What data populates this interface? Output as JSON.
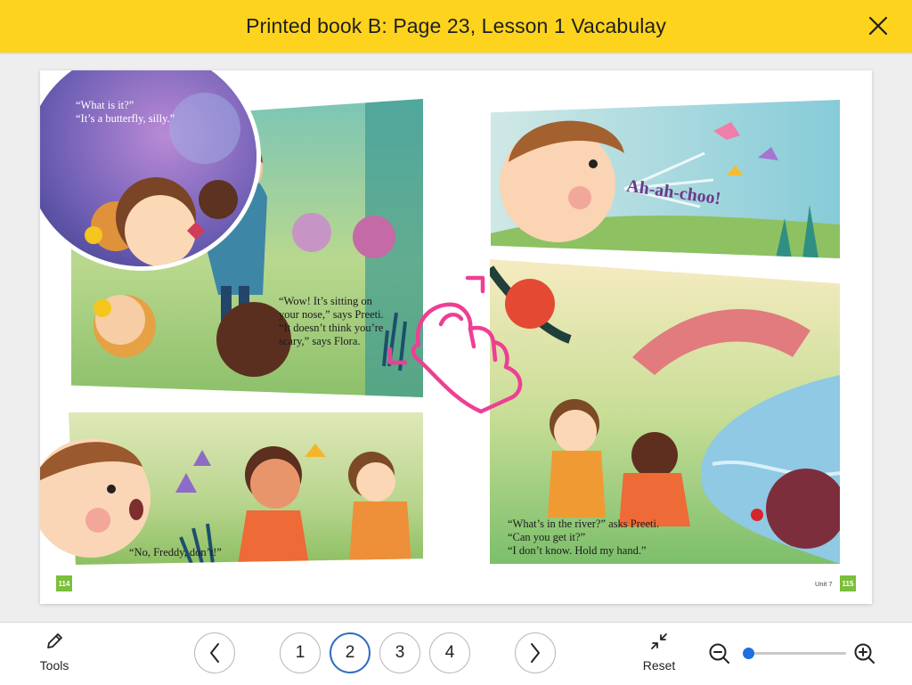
{
  "header": {
    "title": "Printed book B: Page 23, Lesson 1 Vacabulay",
    "close_icon": "close-icon"
  },
  "book": {
    "captions": {
      "butterfly": "“What is it?”\n“It’s a butterfly, silly.”",
      "nose": "“Wow! It’s sitting on\nyour nose,” says Preeti.\n“It doesn’t think you’re\nscary,” says Flora.",
      "freddy": "“No, Freddy, don’t!”",
      "sneeze": "Ah-ah-choo!",
      "river": "“What’s in the river?” asks Preeti.\n“Can you get it?”\n“I don’t know. Hold my hand.”"
    },
    "left_page_number": "114",
    "right_page_number": "115",
    "unit_label": "Unit 7",
    "gesture_icon": "pinch-zoom-gesture-icon",
    "gesture_color": "#ee3f94"
  },
  "footer": {
    "tools_label": "Tools",
    "tools_icon": "pencil-icon",
    "prev_icon": "chevron-left-icon",
    "next_icon": "chevron-right-icon",
    "pages": [
      "1",
      "2",
      "3",
      "4"
    ],
    "active_page": "2",
    "reset_label": "Reset",
    "reset_icon": "collapse-arrows-icon",
    "zoom_out_icon": "zoom-out-icon",
    "zoom_in_icon": "zoom-in-icon",
    "zoom_level": 0.02
  },
  "colors": {
    "header_bg": "#fdd31d",
    "accent": "#2f6bc5",
    "page_badge": "#7bbf3a"
  }
}
